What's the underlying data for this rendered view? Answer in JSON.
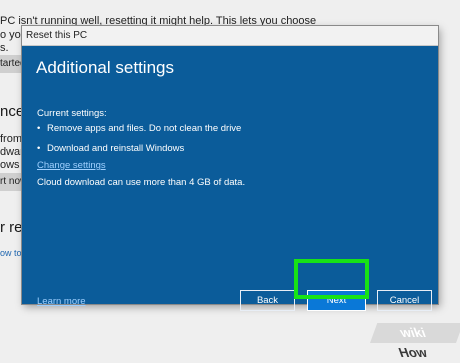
{
  "background": {
    "top_line": "PC isn't running well, resetting it might help. This lets you choose",
    "frag_your": "o your",
    "frag_s": "s.",
    "get_started_btn": "tarted",
    "heading_advanced": "nced",
    "frag_from": "from",
    "frag_dware": "dware",
    "frag_ows": "ows fro",
    "restart_btn": "rt now",
    "heading_recovery": "r reco",
    "link_howto": "ow to"
  },
  "dialog": {
    "title": "Reset this PC",
    "heading": "Additional settings",
    "current_settings_label": "Current settings:",
    "bullets": [
      "Remove apps and files. Do not clean the drive",
      "Download and reinstall Windows"
    ],
    "bullet_char": "•",
    "change_settings_link": "Change settings",
    "cloud_note": "Cloud download can use more than 4 GB of data.",
    "learn_more_link": "Learn more",
    "buttons": {
      "back": "Back",
      "next": "Next",
      "cancel": "Cancel"
    }
  },
  "colors": {
    "dialog_blue": "#0b5c9a",
    "next_button": "#0a78d7",
    "highlight": "#17e317",
    "link": "#9fd0ff"
  },
  "watermark": {
    "part1": "wiki",
    "part2": "How"
  }
}
